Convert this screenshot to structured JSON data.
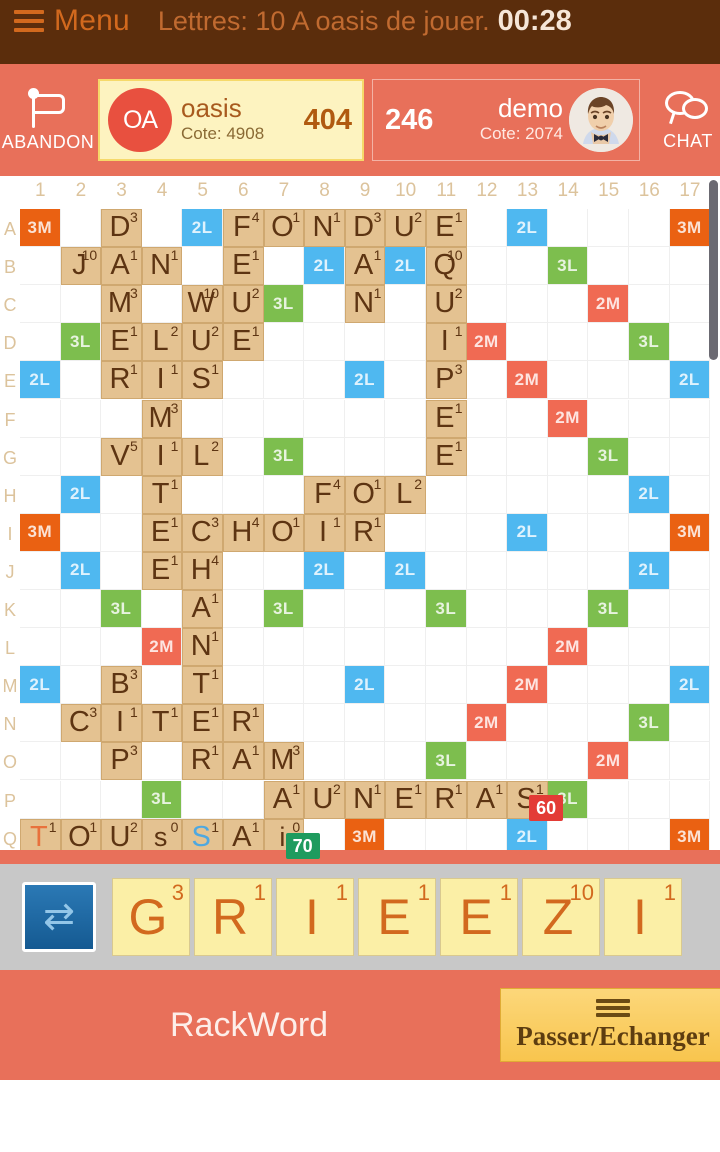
{
  "menubar": {
    "menu_label": "Menu",
    "hamburger_icon": "hamburger-menu-icon",
    "status_text": "Lettres: 10 A oasis de jouer.",
    "timer": "00:28"
  },
  "playerbar": {
    "abandon": {
      "label": "ABANDON",
      "icon": "flag-icon"
    },
    "chat": {
      "label": "CHAT",
      "icon": "chat-bubble-icon"
    },
    "players": [
      {
        "initials": "OA",
        "name": "oasis",
        "rating_label": "Cote: 4908",
        "score": "404",
        "active": true
      },
      {
        "initials": "",
        "name": "demo",
        "rating_label": "Cote: 2074",
        "score": "246",
        "active": false
      }
    ]
  },
  "board": {
    "columns": [
      "1",
      "2",
      "3",
      "4",
      "5",
      "6",
      "7",
      "8",
      "9",
      "10",
      "11",
      "12",
      "13",
      "14",
      "15",
      "16",
      "17"
    ],
    "rows": [
      "A",
      "B",
      "C",
      "D",
      "E",
      "F",
      "G",
      "H",
      "I",
      "J",
      "K",
      "L",
      "M",
      "N",
      "O",
      "P",
      "Q"
    ],
    "bonus_legend": {
      "2L": "double letter",
      "3L": "triple letter",
      "2M": "double word",
      "3M": "triple word"
    },
    "colors": {
      "double_letter": "#4fb8f0",
      "triple_letter": "#7dbe4e",
      "double_word": "#f06a53",
      "triple_word": "#ea6112",
      "tile": "#e4c291",
      "tile_text": "#5d3412"
    },
    "bonuses": [
      {
        "r": 0,
        "c": 0,
        "t": "3M"
      },
      {
        "r": 0,
        "c": 4,
        "t": "2L"
      },
      {
        "r": 0,
        "c": 12,
        "t": "2L"
      },
      {
        "r": 0,
        "c": 16,
        "t": "3M"
      },
      {
        "r": 1,
        "c": 7,
        "t": "2L"
      },
      {
        "r": 1,
        "c": 9,
        "t": "2L"
      },
      {
        "r": 1,
        "c": 13,
        "t": "3L"
      },
      {
        "r": 2,
        "c": 6,
        "t": "3L"
      },
      {
        "r": 2,
        "c": 14,
        "t": "2M"
      },
      {
        "r": 3,
        "c": 1,
        "t": "3L"
      },
      {
        "r": 3,
        "c": 11,
        "t": "2M"
      },
      {
        "r": 3,
        "c": 15,
        "t": "3L"
      },
      {
        "r": 4,
        "c": 0,
        "t": "2L"
      },
      {
        "r": 4,
        "c": 8,
        "t": "2L"
      },
      {
        "r": 4,
        "c": 12,
        "t": "2M"
      },
      {
        "r": 4,
        "c": 16,
        "t": "2L"
      },
      {
        "r": 5,
        "c": 13,
        "t": "2M"
      },
      {
        "r": 6,
        "c": 6,
        "t": "3L"
      },
      {
        "r": 6,
        "c": 14,
        "t": "3L"
      },
      {
        "r": 7,
        "c": 1,
        "t": "2L"
      },
      {
        "r": 7,
        "c": 15,
        "t": "2L"
      },
      {
        "r": 8,
        "c": 0,
        "t": "3M"
      },
      {
        "r": 8,
        "c": 12,
        "t": "2L"
      },
      {
        "r": 8,
        "c": 16,
        "t": "3M"
      },
      {
        "r": 9,
        "c": 1,
        "t": "2L"
      },
      {
        "r": 9,
        "c": 7,
        "t": "2L"
      },
      {
        "r": 9,
        "c": 9,
        "t": "2L"
      },
      {
        "r": 9,
        "c": 15,
        "t": "2L"
      },
      {
        "r": 10,
        "c": 2,
        "t": "3L"
      },
      {
        "r": 10,
        "c": 6,
        "t": "3L"
      },
      {
        "r": 10,
        "c": 10,
        "t": "3L"
      },
      {
        "r": 10,
        "c": 14,
        "t": "3L"
      },
      {
        "r": 11,
        "c": 3,
        "t": "2M"
      },
      {
        "r": 11,
        "c": 13,
        "t": "2M"
      },
      {
        "r": 12,
        "c": 0,
        "t": "2L"
      },
      {
        "r": 12,
        "c": 8,
        "t": "2L"
      },
      {
        "r": 12,
        "c": 12,
        "t": "2M"
      },
      {
        "r": 12,
        "c": 16,
        "t": "2L"
      },
      {
        "r": 13,
        "c": 11,
        "t": "2M"
      },
      {
        "r": 13,
        "c": 15,
        "t": "3L"
      },
      {
        "r": 14,
        "c": 10,
        "t": "3L"
      },
      {
        "r": 14,
        "c": 14,
        "t": "2M"
      },
      {
        "r": 15,
        "c": 3,
        "t": "3L"
      },
      {
        "r": 15,
        "c": 13,
        "t": "3L"
      },
      {
        "r": 16,
        "c": 0,
        "t": "3M"
      },
      {
        "r": 16,
        "c": 8,
        "t": "3M"
      },
      {
        "r": 16,
        "c": 12,
        "t": "2L"
      },
      {
        "r": 16,
        "c": 16,
        "t": "3M"
      }
    ],
    "tiles": [
      {
        "r": 0,
        "c": 2,
        "l": "D",
        "p": "3"
      },
      {
        "r": 0,
        "c": 5,
        "l": "F",
        "p": "4"
      },
      {
        "r": 0,
        "c": 6,
        "l": "O",
        "p": "1"
      },
      {
        "r": 0,
        "c": 7,
        "l": "N",
        "p": "1"
      },
      {
        "r": 0,
        "c": 8,
        "l": "D",
        "p": "3"
      },
      {
        "r": 0,
        "c": 9,
        "l": "U",
        "p": "2"
      },
      {
        "r": 0,
        "c": 10,
        "l": "E",
        "p": "1"
      },
      {
        "r": 1,
        "c": 1,
        "l": "J",
        "p": "10"
      },
      {
        "r": 1,
        "c": 2,
        "l": "A",
        "p": "1"
      },
      {
        "r": 1,
        "c": 3,
        "l": "N",
        "p": "1"
      },
      {
        "r": 1,
        "c": 5,
        "l": "E",
        "p": "1"
      },
      {
        "r": 1,
        "c": 8,
        "l": "A",
        "p": "1"
      },
      {
        "r": 1,
        "c": 10,
        "l": "Q",
        "p": "10"
      },
      {
        "r": 2,
        "c": 2,
        "l": "M",
        "p": "3"
      },
      {
        "r": 2,
        "c": 4,
        "l": "W",
        "p": "10"
      },
      {
        "r": 2,
        "c": 5,
        "l": "U",
        "p": "2"
      },
      {
        "r": 2,
        "c": 8,
        "l": "N",
        "p": "1"
      },
      {
        "r": 2,
        "c": 10,
        "l": "U",
        "p": "2"
      },
      {
        "r": 3,
        "c": 2,
        "l": "E",
        "p": "1"
      },
      {
        "r": 3,
        "c": 3,
        "l": "L",
        "p": "2"
      },
      {
        "r": 3,
        "c": 4,
        "l": "U",
        "p": "2"
      },
      {
        "r": 3,
        "c": 5,
        "l": "E",
        "p": "1"
      },
      {
        "r": 3,
        "c": 10,
        "l": "I",
        "p": "1"
      },
      {
        "r": 4,
        "c": 2,
        "l": "R",
        "p": "1"
      },
      {
        "r": 4,
        "c": 3,
        "l": "I",
        "p": "1"
      },
      {
        "r": 4,
        "c": 4,
        "l": "S",
        "p": "1"
      },
      {
        "r": 4,
        "c": 10,
        "l": "P",
        "p": "3"
      },
      {
        "r": 5,
        "c": 3,
        "l": "M",
        "p": "3"
      },
      {
        "r": 5,
        "c": 10,
        "l": "E",
        "p": "1"
      },
      {
        "r": 6,
        "c": 2,
        "l": "V",
        "p": "5"
      },
      {
        "r": 6,
        "c": 3,
        "l": "I",
        "p": "1"
      },
      {
        "r": 6,
        "c": 4,
        "l": "L",
        "p": "2"
      },
      {
        "r": 6,
        "c": 10,
        "l": "E",
        "p": "1"
      },
      {
        "r": 7,
        "c": 3,
        "l": "T",
        "p": "1"
      },
      {
        "r": 7,
        "c": 7,
        "l": "F",
        "p": "4"
      },
      {
        "r": 7,
        "c": 8,
        "l": "O",
        "p": "1"
      },
      {
        "r": 7,
        "c": 9,
        "l": "L",
        "p": "2"
      },
      {
        "r": 8,
        "c": 3,
        "l": "E",
        "p": "1"
      },
      {
        "r": 8,
        "c": 4,
        "l": "C",
        "p": "3"
      },
      {
        "r": 8,
        "c": 5,
        "l": "H",
        "p": "4"
      },
      {
        "r": 8,
        "c": 6,
        "l": "O",
        "p": "1"
      },
      {
        "r": 8,
        "c": 7,
        "l": "I",
        "p": "1"
      },
      {
        "r": 8,
        "c": 8,
        "l": "R",
        "p": "1"
      },
      {
        "r": 9,
        "c": 3,
        "l": "E",
        "p": "1"
      },
      {
        "r": 9,
        "c": 4,
        "l": "H",
        "p": "4"
      },
      {
        "r": 10,
        "c": 4,
        "l": "A",
        "p": "1"
      },
      {
        "r": 11,
        "c": 4,
        "l": "N",
        "p": "1"
      },
      {
        "r": 12,
        "c": 2,
        "l": "B",
        "p": "3"
      },
      {
        "r": 12,
        "c": 4,
        "l": "T",
        "p": "1"
      },
      {
        "r": 13,
        "c": 1,
        "l": "C",
        "p": "3"
      },
      {
        "r": 13,
        "c": 2,
        "l": "I",
        "p": "1"
      },
      {
        "r": 13,
        "c": 3,
        "l": "T",
        "p": "1"
      },
      {
        "r": 13,
        "c": 4,
        "l": "E",
        "p": "1"
      },
      {
        "r": 13,
        "c": 5,
        "l": "R",
        "p": "1"
      },
      {
        "r": 14,
        "c": 2,
        "l": "P",
        "p": "3"
      },
      {
        "r": 14,
        "c": 4,
        "l": "R",
        "p": "1"
      },
      {
        "r": 14,
        "c": 5,
        "l": "A",
        "p": "1"
      },
      {
        "r": 14,
        "c": 6,
        "l": "M",
        "p": "3"
      },
      {
        "r": 15,
        "c": 6,
        "l": "A",
        "p": "1"
      },
      {
        "r": 15,
        "c": 7,
        "l": "U",
        "p": "2"
      },
      {
        "r": 15,
        "c": 8,
        "l": "N",
        "p": "1"
      },
      {
        "r": 15,
        "c": 9,
        "l": "E",
        "p": "1"
      },
      {
        "r": 15,
        "c": 10,
        "l": "R",
        "p": "1"
      },
      {
        "r": 15,
        "c": 11,
        "l": "A",
        "p": "1"
      },
      {
        "r": 15,
        "c": 12,
        "l": "S",
        "p": "1"
      },
      {
        "r": 16,
        "c": 0,
        "l": "T",
        "p": "1",
        "style": "orange"
      },
      {
        "r": 16,
        "c": 1,
        "l": "O",
        "p": "1"
      },
      {
        "r": 16,
        "c": 2,
        "l": "U",
        "p": "2"
      },
      {
        "r": 16,
        "c": 3,
        "l": "s",
        "p": "0",
        "style": "lc"
      },
      {
        "r": 16,
        "c": 4,
        "l": "S",
        "p": "1",
        "style": "blue"
      },
      {
        "r": 16,
        "c": 5,
        "l": "A",
        "p": "1"
      },
      {
        "r": 16,
        "c": 6,
        "l": "i",
        "p": "0",
        "style": "lc"
      }
    ],
    "score_badges": [
      {
        "value": "70",
        "color": "green",
        "r": 16,
        "c": 6
      },
      {
        "value": "60",
        "color": "red",
        "r": 15,
        "c": 12
      }
    ]
  },
  "rack": {
    "shuffle_icon": "shuffle-icon",
    "tiles": [
      {
        "letter": "G",
        "points": "3"
      },
      {
        "letter": "R",
        "points": "1"
      },
      {
        "letter": "I",
        "points": "1"
      },
      {
        "letter": "E",
        "points": "1"
      },
      {
        "letter": "E",
        "points": "1"
      },
      {
        "letter": "Z",
        "points": "10"
      },
      {
        "letter": "I",
        "points": "1"
      }
    ]
  },
  "footer": {
    "rackword_label": "RackWord",
    "pass_button": {
      "label": "Passer/Echanger",
      "icon": "hamburger-menu-icon"
    }
  }
}
